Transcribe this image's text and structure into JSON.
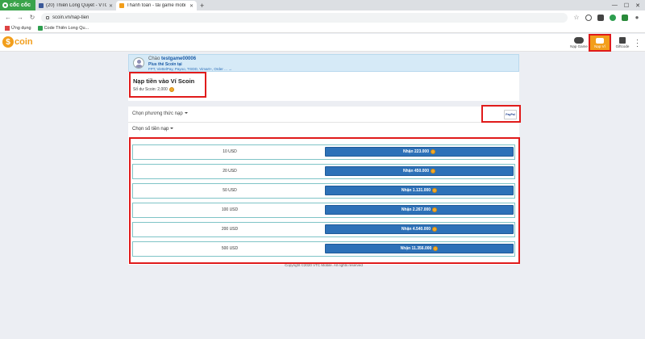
{
  "browser": {
    "brand": "cốc cốc",
    "tabs": [
      {
        "title": "(20) Thiên Long Quyết - VTC",
        "icon_color": "#3b5998"
      },
      {
        "title": "Thanh toán - tải game mobi",
        "icon_color": "#f29e1b"
      }
    ],
    "new_tab": "+",
    "url": "scoin.vn/nap-tien",
    "bookmarks": [
      {
        "label": "Ứng dụng"
      },
      {
        "label": "Code Thiên Long Qu..."
      }
    ]
  },
  "site": {
    "logo_text": "coin",
    "logo_letter": "$",
    "nav": [
      {
        "label": "Nạp Game"
      },
      {
        "label": "Nạp Ví"
      },
      {
        "label": "Giftcode"
      }
    ],
    "accent": "#f29e1b",
    "button_color": "#2d71b8",
    "highlight_color": "#e01b1b"
  },
  "profile": {
    "greeting": "Chào",
    "username": "testgame00006",
    "promo": "Plus thẻ Scoin tại",
    "methods": "FPT, ViettelPay, Payoo, TGDD, Vimart+, Order ... →"
  },
  "wallet": {
    "title": "Nạp tiền vào Ví Scoin",
    "balance_label": "Số dư Scoin: 2,000"
  },
  "payment": {
    "method_label": "Chọn phương thức nạp",
    "selected": "PayPal",
    "amount_label": "Chọn số tiền nạp"
  },
  "packages": [
    {
      "amount": "10 USD",
      "button": "Nhận 223.000"
    },
    {
      "amount": "20 USD",
      "button": "Nhận 450.000"
    },
    {
      "amount": "50 USD",
      "button": "Nhận 1.131.000"
    },
    {
      "amount": "100 USD",
      "button": "Nhận 2.267.000"
    },
    {
      "amount": "200 USD",
      "button": "Nhận 4.540.000"
    },
    {
      "amount": "500 USD",
      "button": "Nhận 11.356.000"
    }
  ],
  "footer": "Copyright ©2020 VTC Mobile. All rights reserved"
}
